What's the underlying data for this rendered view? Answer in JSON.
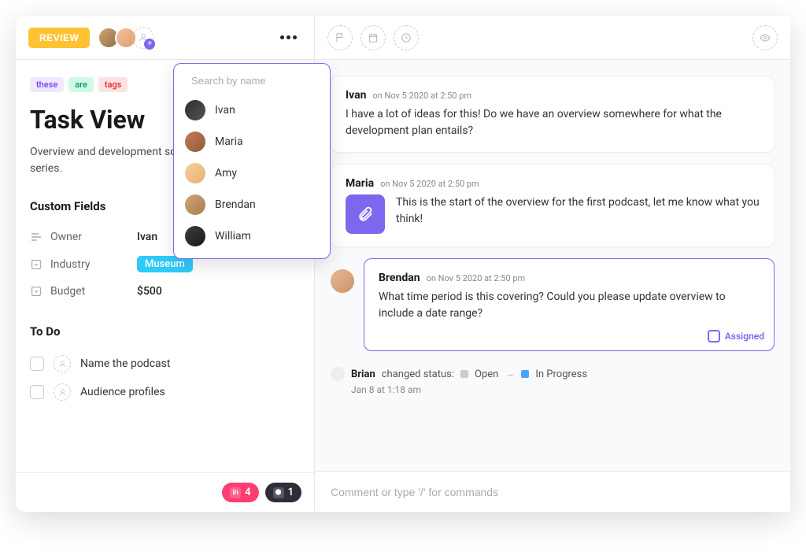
{
  "header": {
    "review_label": "REVIEW",
    "search_placeholder": "Search by name"
  },
  "people": [
    {
      "name": "Ivan"
    },
    {
      "name": "Maria"
    },
    {
      "name": "Amy"
    },
    {
      "name": "Brendan"
    },
    {
      "name": "William"
    }
  ],
  "tags": [
    {
      "text": "these",
      "color": "purple"
    },
    {
      "text": "are",
      "color": "green"
    },
    {
      "text": "tags",
      "color": "red"
    }
  ],
  "task": {
    "title": "Task View",
    "description": "Overview and development scope for original podcast series."
  },
  "custom_fields": {
    "heading": "Custom Fields",
    "rows": [
      {
        "label": "Owner",
        "value": "Ivan",
        "type": "text"
      },
      {
        "label": "Industry",
        "value": "Museum",
        "type": "chip"
      },
      {
        "label": "Budget",
        "value": "$500",
        "type": "text"
      }
    ]
  },
  "todo": {
    "heading": "To Do",
    "items": [
      {
        "text": "Name the podcast"
      },
      {
        "text": "Audience profiles"
      }
    ]
  },
  "attachments": {
    "pink_count": "4",
    "dark_count": "1"
  },
  "comments": [
    {
      "author": "Ivan",
      "time": "on Nov 5 2020 at 2:50 pm",
      "body": "I have a lot of ideas for this! Do we have an overview somewhere for what the development plan entails?"
    },
    {
      "author": "Maria",
      "time": "on Nov 5 2020 at 2:50 pm",
      "body": "This is the start of the overview for the first podcast, let me know what you think!",
      "attachment": true
    },
    {
      "author": "Brendan",
      "time": "on Nov 5 2020 at 2:50 pm",
      "body": "What time period is this covering? Could you please update overview to include a date range?",
      "assigned": true,
      "assigned_label": "Assigned",
      "side_avatar": true
    }
  ],
  "status_change": {
    "user": "Brian",
    "verb": "changed status:",
    "from": "Open",
    "to": "In Progress",
    "time": "Jan 8 at 1:18 am"
  },
  "composer": {
    "placeholder": "Comment or type '/' for commands"
  }
}
